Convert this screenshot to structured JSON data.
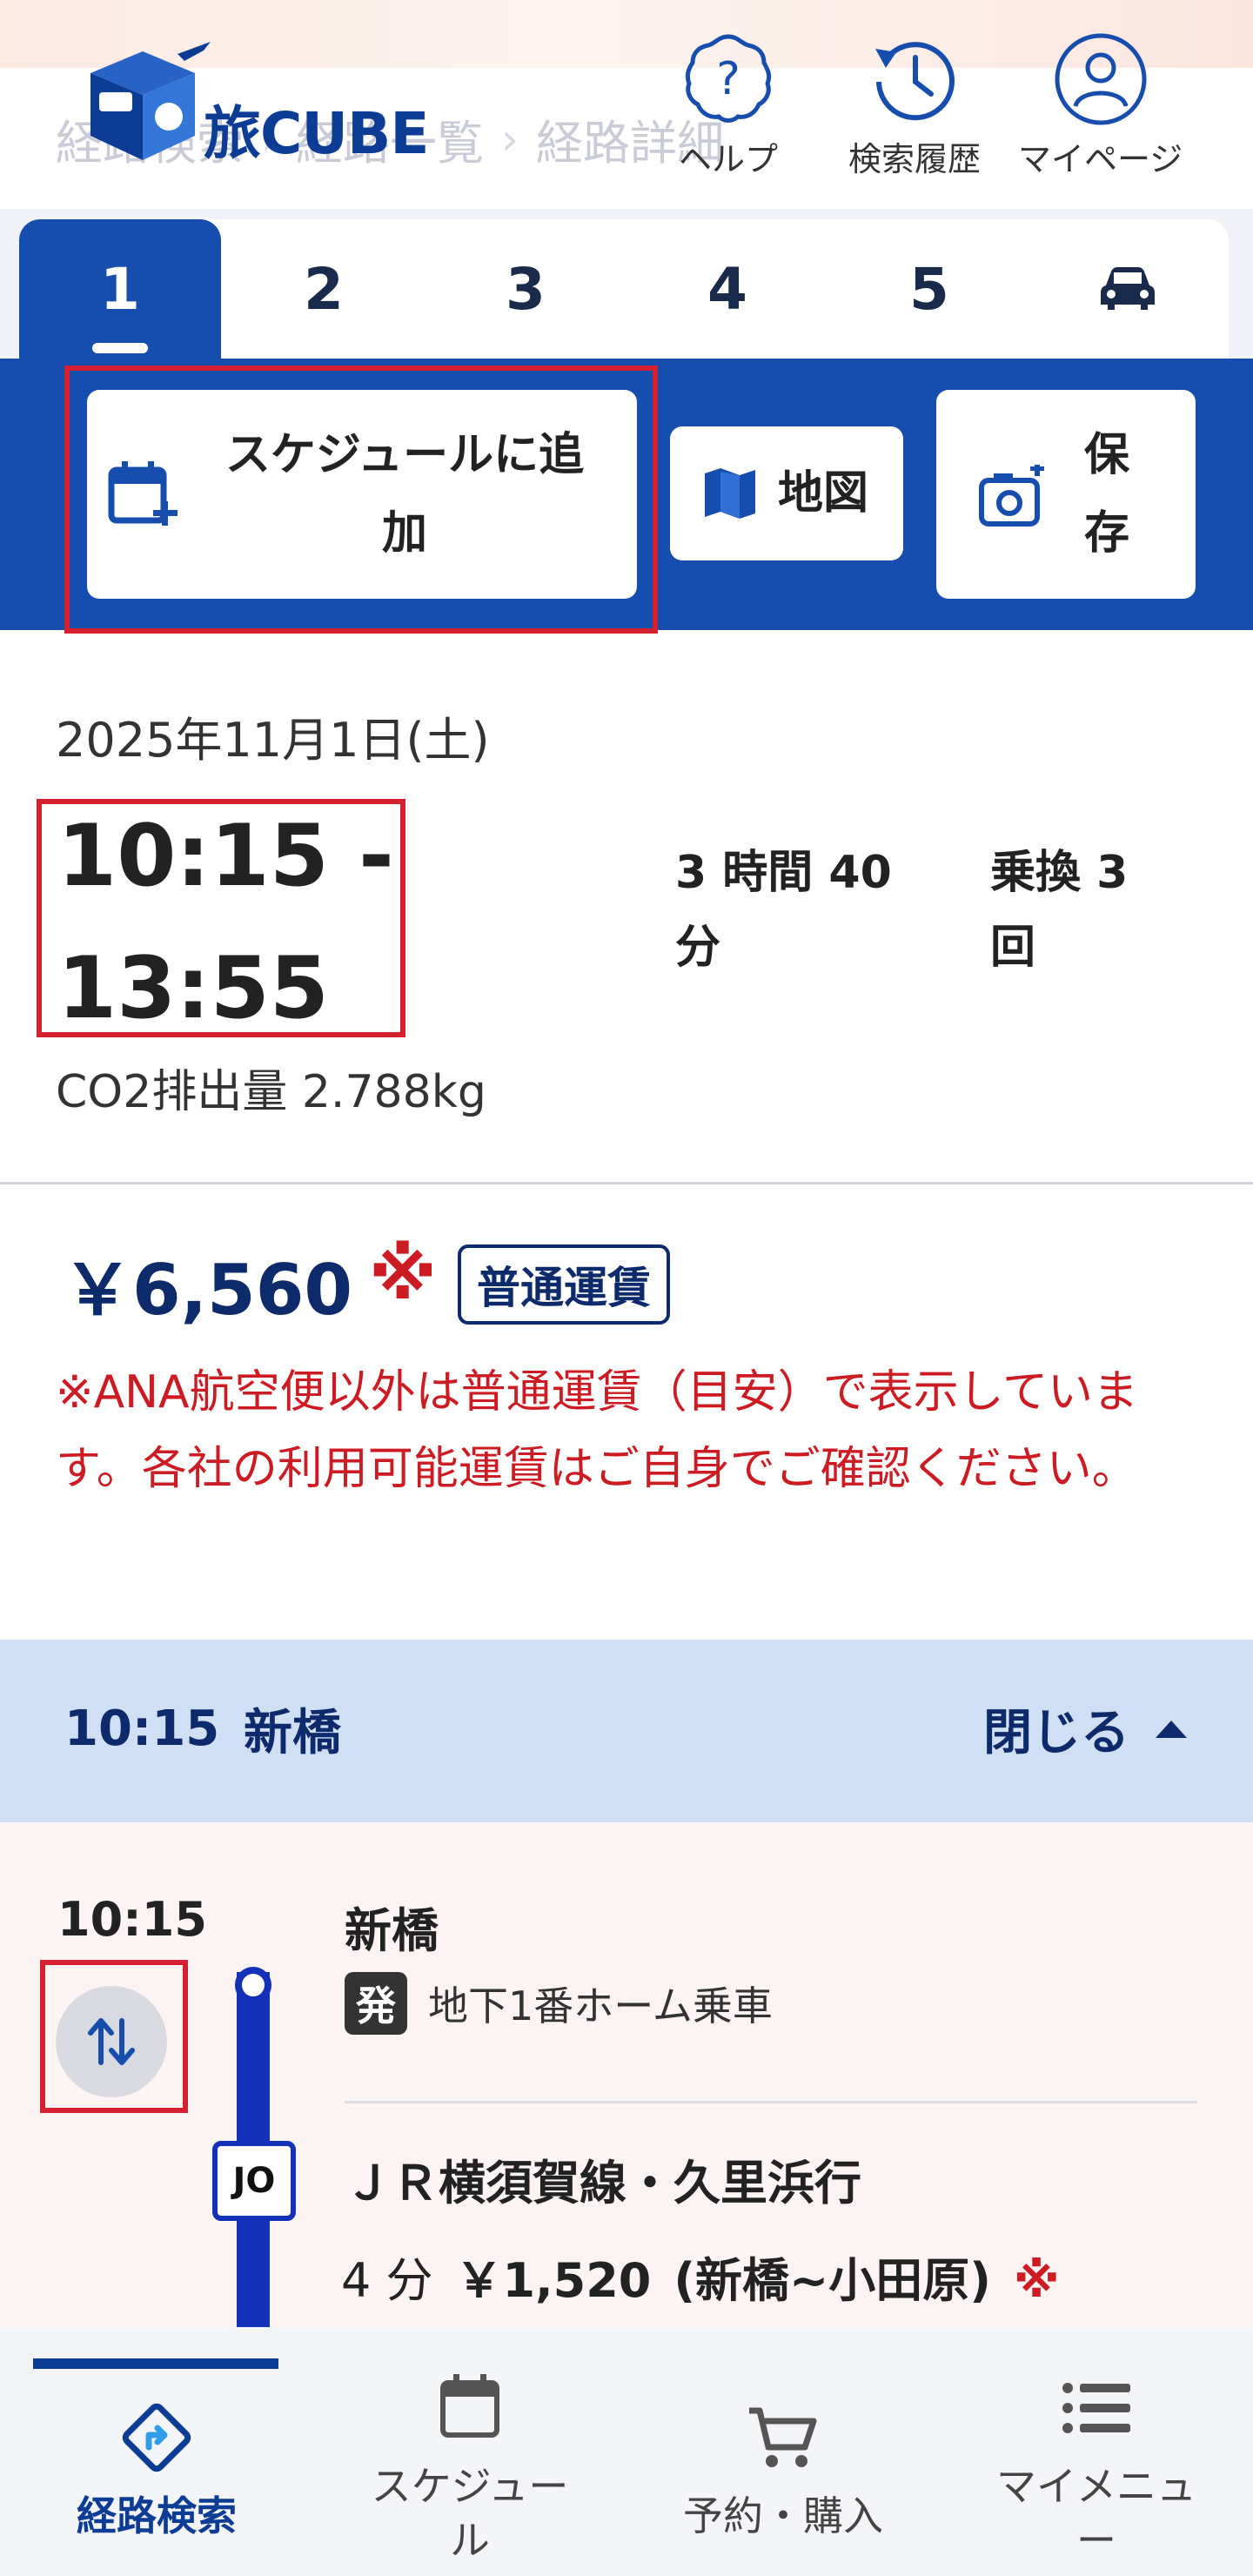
{
  "header": {
    "logo_text": "旅CUBE",
    "breadcrumb": [
      "経路検索",
      "経路一覧",
      "経路詳細"
    ],
    "help_label": "ヘルプ",
    "history_label": "検索履歴",
    "mypage_label": "マイページ"
  },
  "tabs": [
    {
      "label": "1",
      "active": true
    },
    {
      "label": "2"
    },
    {
      "label": "3"
    },
    {
      "label": "4"
    },
    {
      "label": "5"
    },
    {
      "icon": "car-icon"
    }
  ],
  "actions": {
    "schedule_add_label_line1": "スケジュールに追",
    "schedule_add_label_line2": "加",
    "map_label": "地図",
    "save_label_line1": "保",
    "save_label_line2": "存"
  },
  "summary": {
    "date": "2025年11月1日(土)",
    "time_range_line1": "10:15 -",
    "time_range_line2": "13:55",
    "duration_line1": "3 時間 40",
    "duration_line2": "分",
    "transfers_line1": "乗換 3",
    "transfers_line2": "回",
    "co2": "CO2排出量 2.788kg"
  },
  "fare": {
    "amount": "￥6,560",
    "mark": "※",
    "badge": "普通運賃",
    "note": "※ANA航空便以外は普通運賃（目安）で表示しています。各社の利用可能運賃はご自身でご確認ください。"
  },
  "section": {
    "time": "10:15",
    "station": "新橋",
    "close_label": "閉じる"
  },
  "route": {
    "time": "10:15",
    "station": "新橋",
    "dep_badge": "発",
    "dep_text": "地下1番ホーム乗車",
    "line_code": "JO",
    "line_name": "ＪＲ横須賀線・久里浜行",
    "duration": "4 分",
    "fare": "￥1,520",
    "fare_range": "(新橋~小田原)",
    "fare_mark": "※"
  },
  "bottom_nav": [
    {
      "label": "経路検索",
      "active": true
    },
    {
      "label": "スケジュール"
    },
    {
      "label": "予約・購入"
    },
    {
      "label": "マイメニュー"
    }
  ],
  "colors": {
    "primary": "#174ead",
    "navy": "#0d2a6b",
    "alert_red": "#cc1b22",
    "section_bg": "#d1dff5"
  }
}
